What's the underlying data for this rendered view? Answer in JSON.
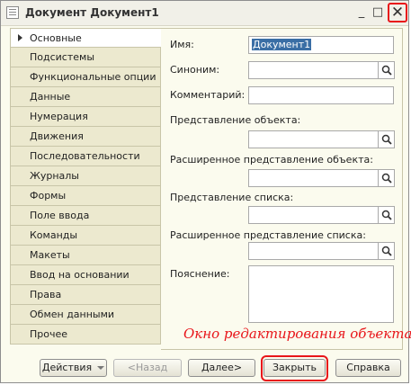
{
  "window": {
    "title": "Документ Документ1",
    "minimize_glyph": "_",
    "maximize_glyph": "□",
    "close_glyph": "✕"
  },
  "tabs": [
    {
      "label": "Основные",
      "active": true
    },
    {
      "label": "Подсистемы"
    },
    {
      "label": "Функциональные опции"
    },
    {
      "label": "Данные"
    },
    {
      "label": "Нумерация"
    },
    {
      "label": "Движения"
    },
    {
      "label": "Последовательности"
    },
    {
      "label": "Журналы"
    },
    {
      "label": "Формы"
    },
    {
      "label": "Поле ввода"
    },
    {
      "label": "Команды"
    },
    {
      "label": "Макеты"
    },
    {
      "label": "Ввод на основании"
    },
    {
      "label": "Права"
    },
    {
      "label": "Обмен данными"
    },
    {
      "label": "Прочее"
    }
  ],
  "form": {
    "name_label": "Имя:",
    "name_value": "Документ1",
    "synonym_label": "Синоним:",
    "synonym_value": "",
    "comment_label": "Комментарий:",
    "comment_value": "",
    "object_repr_label": "Представление объекта:",
    "object_repr_value": "",
    "ext_object_repr_label": "Расширенное представление объекта:",
    "ext_object_repr_value": "",
    "list_repr_label": "Представление списка:",
    "list_repr_value": "",
    "ext_list_repr_label": "Расширенное представление списка:",
    "ext_list_repr_value": "",
    "explanation_label": "Пояснение:",
    "explanation_value": ""
  },
  "annotation": "Окно редактирования объекта",
  "buttons": {
    "actions": "Действия",
    "back": "<Назад",
    "next": "Далее>",
    "close": "Закрыть",
    "help": "Справка"
  },
  "colors": {
    "highlight": "#e8151a",
    "selection": "#3a6ea5",
    "tab_bg": "#ece9cf",
    "panel_bg": "#fbfbee"
  },
  "icons": [
    "window-icon",
    "search-icon",
    "tab-arrow-icon",
    "dropdown-icon"
  ]
}
